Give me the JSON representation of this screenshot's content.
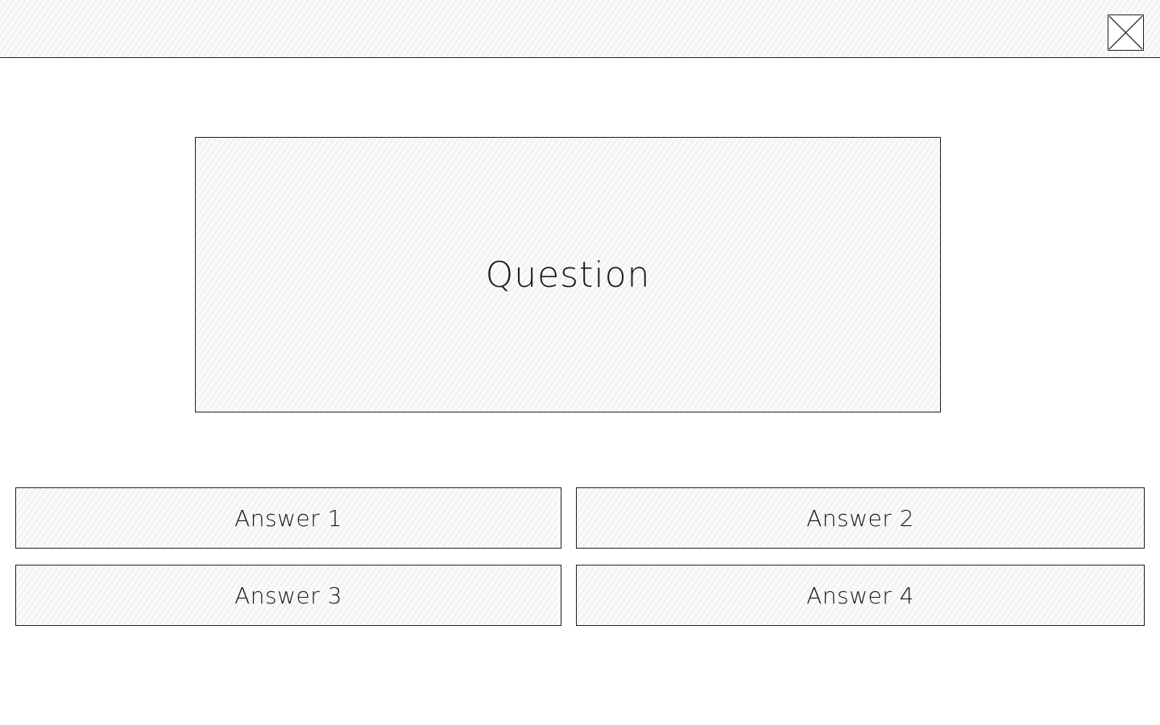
{
  "header": {
    "close_icon": "close-x-icon"
  },
  "question": {
    "text": "Question"
  },
  "answers": [
    {
      "label": "Answer 1"
    },
    {
      "label": "Answer 2"
    },
    {
      "label": "Answer 3"
    },
    {
      "label": "Answer 4"
    }
  ],
  "colors": {
    "stroke": "#222222",
    "background": "#ffffff",
    "hatch": "#fafafa"
  }
}
